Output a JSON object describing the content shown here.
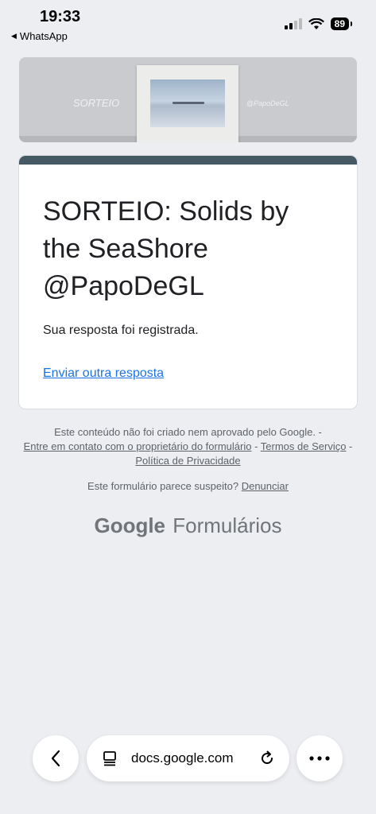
{
  "status_bar": {
    "time": "19:33",
    "back_app": "WhatsApp",
    "battery": "89"
  },
  "banner": {
    "left_text": "SORTEIO",
    "right_text": "@PapoDeGL"
  },
  "card": {
    "title": "SORTEIO: Solids by the SeaShore @PapoDeGL",
    "message": "Sua resposta foi registrada.",
    "link": "Enviar outra resposta",
    "accent_color": "#465a66"
  },
  "footer": {
    "disclaimer_text": "Este conteúdo não foi criado nem aprovado pelo Google. -",
    "contact_link": "Entre em contato com o proprietário do formulário",
    "sep1": " - ",
    "terms_link": "Termos de Serviço",
    "sep2": " - ",
    "privacy_link": "Política de Privacidade",
    "report_text": "Este formulário parece suspeito?",
    "report_link": "Denunciar",
    "brand_google": "Google",
    "brand_product": "Formulários"
  },
  "browser": {
    "url": "docs.google.com",
    "icons": [
      "back-icon",
      "page-icon",
      "reload-icon",
      "more-icon"
    ]
  }
}
